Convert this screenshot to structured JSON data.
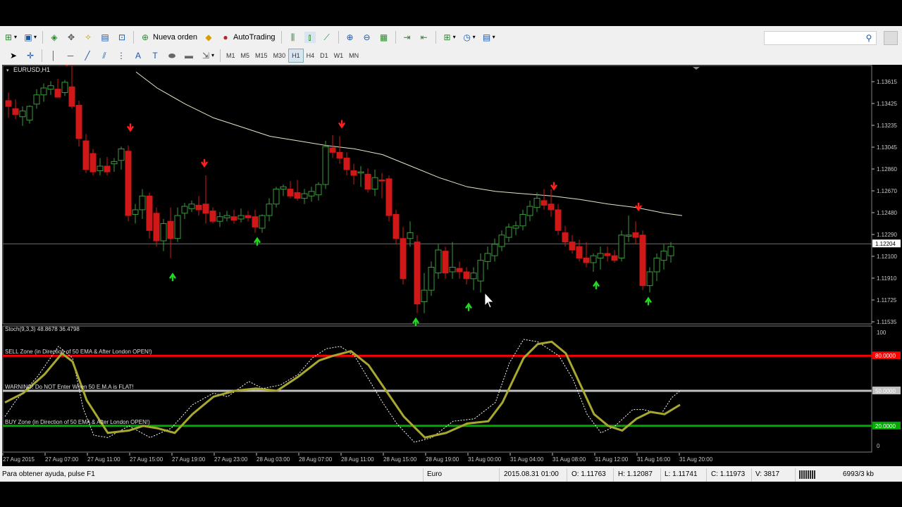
{
  "toolbar": {
    "new_order": "Nueva orden",
    "autotrading": "AutoTrading",
    "timeframes": [
      "M1",
      "M5",
      "M15",
      "M30",
      "H1",
      "H4",
      "D1",
      "W1",
      "MN"
    ],
    "active_timeframe": "H1",
    "search_placeholder": ""
  },
  "chart": {
    "symbol_label": "EURUSD,H1",
    "price_scale": [
      "1.13615",
      "1.13425",
      "1.13235",
      "1.13045",
      "1.12860",
      "1.12670",
      "1.12480",
      "1.12290",
      "1.12100",
      "1.11910",
      "1.11725",
      "1.11535"
    ],
    "current_price": "1.12204",
    "time_axis": [
      "27 Aug 2015",
      "27 Aug 07:00",
      "27 Aug 11:00",
      "27 Aug 15:00",
      "27 Aug 19:00",
      "27 Aug 23:00",
      "28 Aug 03:00",
      "28 Aug 07:00",
      "28 Aug 11:00",
      "28 Aug 15:00",
      "28 Aug 19:00",
      "31 Aug 00:00",
      "31 Aug 04:00",
      "31 Aug 08:00",
      "31 Aug 12:00",
      "31 Aug 16:00",
      "31 Aug 20:00"
    ],
    "indicator_label": "Stoch(9,3,3) 48.8678 36.4798",
    "stoch_scale": {
      "top": "100",
      "bottom": "0"
    },
    "zones": [
      {
        "label": "SELL Zone (in Direction of 50 EMA & After London OPEN!)",
        "value": "80.0000",
        "color": "#ff0000"
      },
      {
        "label": "WARNING! Do NOT Enter When 50 E.M.A is FLAT!",
        "value": "50.0000",
        "color": "#c0c0c0"
      },
      {
        "label": "BUY Zone (in Direction of 50 EMA & After London OPEN!)",
        "value": "20.0000",
        "color": "#00aa00"
      }
    ],
    "colors": {
      "bull": "#3a9b3a",
      "bear": "#d01818",
      "ema": "#e8e4c8",
      "stoch_main": "#a8a830",
      "stoch_signal": "#ffffff",
      "arrow_up": "#22d822",
      "arrow_down": "#ff2020"
    }
  },
  "statusbar": {
    "help": "Para obtener ayuda, pulse F1",
    "profile": "Euro",
    "datetime": "2015.08.31 01:00",
    "open": "O: 1.11763",
    "high": "H: 1.12087",
    "low": "L: 1.11741",
    "close": "C: 1.11973",
    "volume": "V: 3817",
    "traffic": "6993/3 kb"
  }
}
